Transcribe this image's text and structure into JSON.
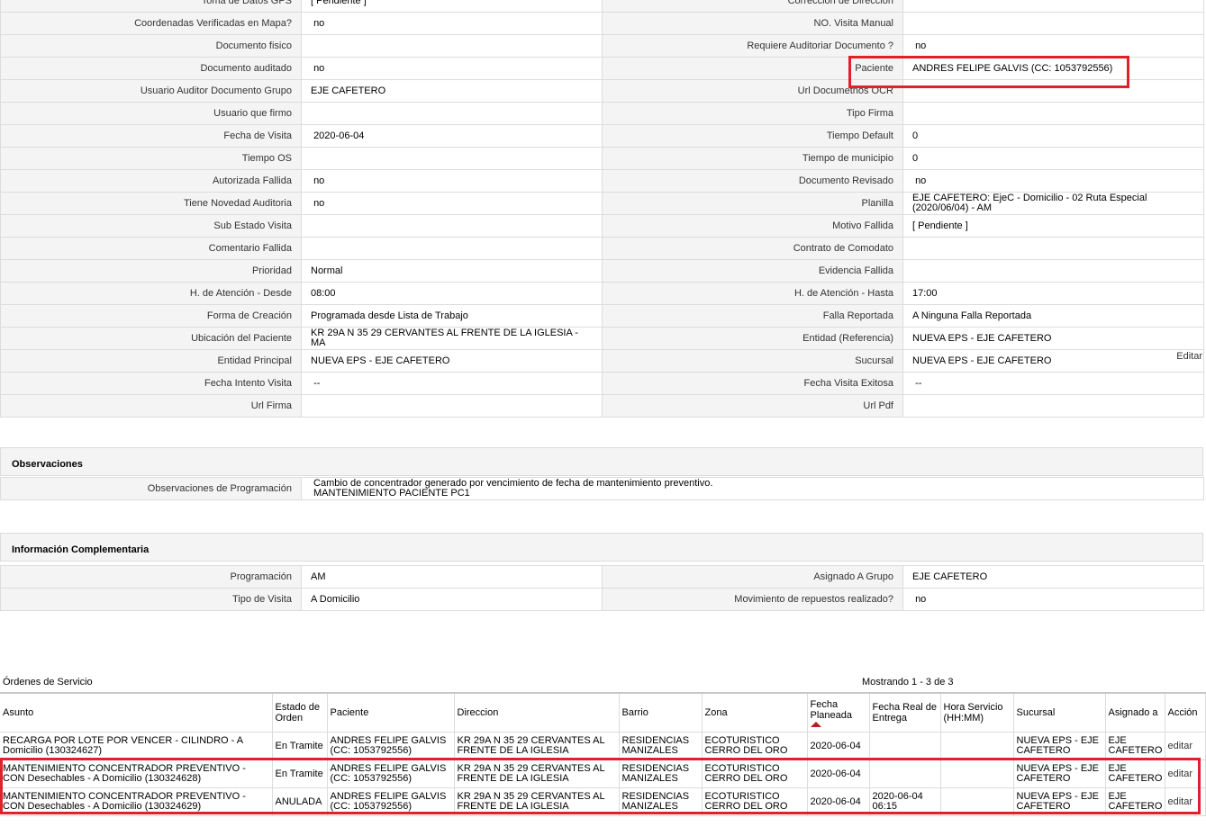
{
  "fields_rows": [
    [
      "Toma de Datos GPS",
      "[ Pendiente ]",
      "Correccion de Direccion",
      ""
    ],
    [
      "Coordenadas Verificadas en Mapa?",
      " no",
      "NO. Visita Manual",
      ""
    ],
    [
      "Documento fisico",
      "",
      "Requiere Auditoriar Documento ?",
      " no"
    ],
    [
      "Documento auditado",
      " no",
      "Paciente",
      "ANDRES FELIPE GALVIS (CC: 1053792556)"
    ],
    [
      "Usuario Auditor Documento Grupo",
      "EJE CAFETERO",
      "Url Documetnos OCR",
      ""
    ],
    [
      "Usuario que firmo",
      "",
      "Tipo Firma",
      ""
    ],
    [
      "Fecha de Visita",
      " 2020-06-04",
      "Tiempo Default",
      "0"
    ],
    [
      "Tiempo OS",
      "",
      "Tiempo de municipio",
      "0"
    ],
    [
      "Autorizada Fallida",
      " no",
      "Documento Revisado",
      " no"
    ],
    [
      "Tiene Novedad Auditoria",
      " no",
      "Planilla",
      "EJE CAFETERO: EjeC - Domicilio - 02 Ruta Especial (2020/06/04) - AM"
    ],
    [
      "Sub Estado Visita",
      "",
      "Motivo Fallida",
      "[ Pendiente ]"
    ],
    [
      "Comentario Fallida",
      "",
      "Contrato de Comodato",
      ""
    ],
    [
      "Prioridad",
      "Normal",
      "Evidencia Fallida",
      ""
    ],
    [
      "H. de Atención - Desde",
      "08:00",
      "H. de Atención - Hasta",
      "17:00"
    ],
    [
      "Forma de Creación",
      "Programada desde Lista de Trabajo",
      "Falla Reportada",
      "A Ninguna Falla Reportada"
    ],
    [
      "Ubicación del Paciente",
      "KR 29A N 35 29 CERVANTES AL FRENTE DE LA IGLESIA - MA",
      "Entidad (Referencia)",
      "NUEVA EPS - EJE CAFETERO"
    ],
    [
      "Entidad Principal",
      "NUEVA EPS - EJE CAFETERO",
      "Sucursal",
      "NUEVA EPS - EJE CAFETERO"
    ],
    [
      "Fecha Intento Visita",
      " --",
      "Fecha Visita Exitosa",
      " --"
    ],
    [
      "Url Firma",
      "",
      "Url Pdf",
      ""
    ]
  ],
  "editar_label": "Editar",
  "observaciones": {
    "title": "Observaciones",
    "label": "Observaciones de Programación",
    "value_line1": " Cambio de concentrador generado por vencimiento de fecha de mantenimiento preventivo.",
    "value_line2": "MANTENIMIENTO PACIENTE PC1"
  },
  "info": {
    "title": "Información Complementaria",
    "rows": [
      [
        "Programación",
        "AM",
        "Asignado A Grupo",
        "EJE CAFETERO"
      ],
      [
        "Tipo de Visita",
        "A Domicilio",
        "Movimiento de repuestos realizado?",
        " no"
      ]
    ]
  },
  "orders": {
    "title": "Órdenes de Servicio",
    "count_text": "Mostrando 1 - 3 de 3",
    "headers": [
      "Asunto",
      "Estado de Orden",
      "Paciente",
      "Direccion",
      "Barrio",
      "Zona",
      "Fecha Planeada",
      "Fecha Real de Entrega",
      "Hora Servicio (HH:MM)",
      "Sucursal",
      "Asignado a",
      "Acción"
    ],
    "rows": [
      [
        "RECARGA POR LOTE POR VENCER - CILINDRO - A Domicilio (130324627)",
        "En Tramite",
        "ANDRES FELIPE GALVIS (CC: 1053792556)",
        "KR 29A N 35 29 CERVANTES AL FRENTE DE LA IGLESIA",
        "RESIDENCIAS MANIZALES",
        "ECOTURISTICO CERRO DEL ORO",
        "2020-06-04",
        "",
        "",
        "NUEVA EPS - EJE CAFETERO",
        "EJE CAFETERO",
        "editar"
      ],
      [
        "MANTENIMIENTO CONCENTRADOR PREVENTIVO - CON Desechables - A Domicilio (130324628)",
        "En Tramite",
        "ANDRES FELIPE GALVIS (CC: 1053792556)",
        "KR 29A N 35 29 CERVANTES AL FRENTE DE LA IGLESIA",
        "RESIDENCIAS MANIZALES",
        "ECOTURISTICO CERRO DEL ORO",
        "2020-06-04",
        "",
        "",
        "NUEVA EPS - EJE CAFETERO",
        "EJE CAFETERO",
        "editar"
      ],
      [
        "MANTENIMIENTO CONCENTRADOR PREVENTIVO - CON Desechables - A Domicilio (130324629)",
        "ANULADA",
        "ANDRES FELIPE GALVIS (CC: 1053792556)",
        "KR 29A N 35 29 CERVANTES AL FRENTE DE LA IGLESIA",
        "RESIDENCIAS MANIZALES",
        "ECOTURISTICO CERRO DEL ORO",
        "2020-06-04",
        "2020-06-04 06:15",
        "",
        "NUEVA EPS - EJE CAFETERO",
        "EJE CAFETERO",
        "editar"
      ]
    ]
  },
  "colors": {
    "highlight": "#e0202a",
    "label_bg": "#f4f4f4",
    "border": "#dcdcdc",
    "sort_arrow": "#b32020"
  }
}
